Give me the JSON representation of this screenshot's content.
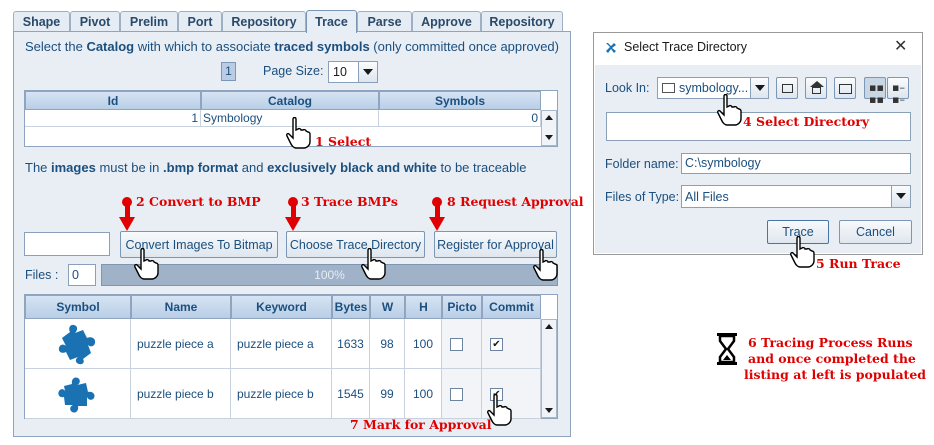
{
  "tabs": [
    "Shape",
    "Pivot",
    "Prelim",
    "Port",
    "Repository",
    "Trace",
    "Parse",
    "Approve",
    "Repository"
  ],
  "active_tab": "Trace",
  "intro": {
    "p1": "Select the ",
    "b1": "Catalog",
    "p2": " with which to associate ",
    "b2": "traced symbols",
    "p3": " (only committed once approved)"
  },
  "paging": {
    "page": "1",
    "page_size_label": "Page Size:",
    "page_size_value": "10"
  },
  "catalog_table": {
    "headers": [
      "Id",
      "Catalog",
      "Symbols"
    ],
    "row": {
      "id": "1",
      "catalog": "Symbology",
      "symbols": "0"
    }
  },
  "images_note": {
    "p1": "The ",
    "b1": "images",
    "p2": " must be in ",
    "b2": ".bmp format",
    "p3": " and ",
    "b3": "exclusively black and white",
    "p4": " to be traceable"
  },
  "buttons": {
    "convert": "Convert Images To Bitmap",
    "choose_dir": "Choose Trace Directory",
    "register": "Register for Approval"
  },
  "files": {
    "label": "Files :",
    "count": "0",
    "progress_text": "100%",
    "progress": 1.0
  },
  "symbol_table": {
    "headers": [
      "Symbol",
      "Name",
      "Keyword",
      "Bytes",
      "W",
      "H",
      "Picto",
      "Commit"
    ],
    "rows": [
      {
        "name": "puzzle piece a",
        "keyword": "puzzle piece a",
        "bytes": "1633",
        "w": "98",
        "h": "100",
        "picto": false,
        "commit": true
      },
      {
        "name": "puzzle piece b",
        "keyword": "puzzle piece b",
        "bytes": "1545",
        "w": "99",
        "h": "100",
        "picto": false,
        "commit": true
      }
    ]
  },
  "annotations": {
    "a1": "1 Select",
    "a2": "2 Convert to BMP",
    "a3": "3 Trace BMPs",
    "a4": "4 Select Directory",
    "a5": "5 Run Trace",
    "a6_l1": "6 Tracing Process Runs",
    "a6_l2": "and once completed the",
    "a6_l3": "listing at left is populated",
    "a7": "7 Mark for Approval",
    "a8": "8 Request Approval"
  },
  "dialog": {
    "title": "Select Trace Directory",
    "look_in_label": "Look In:",
    "look_in_value": "symbology...",
    "folder_label": "Folder name:",
    "folder_value": "C:\\symbology",
    "type_label": "Files of Type:",
    "type_value": "All Files",
    "trace": "Trace",
    "cancel": "Cancel"
  },
  "colors": {
    "accent": "#1b4f7e",
    "annotation": "#e00000",
    "puzzle": "#1b72b3"
  }
}
